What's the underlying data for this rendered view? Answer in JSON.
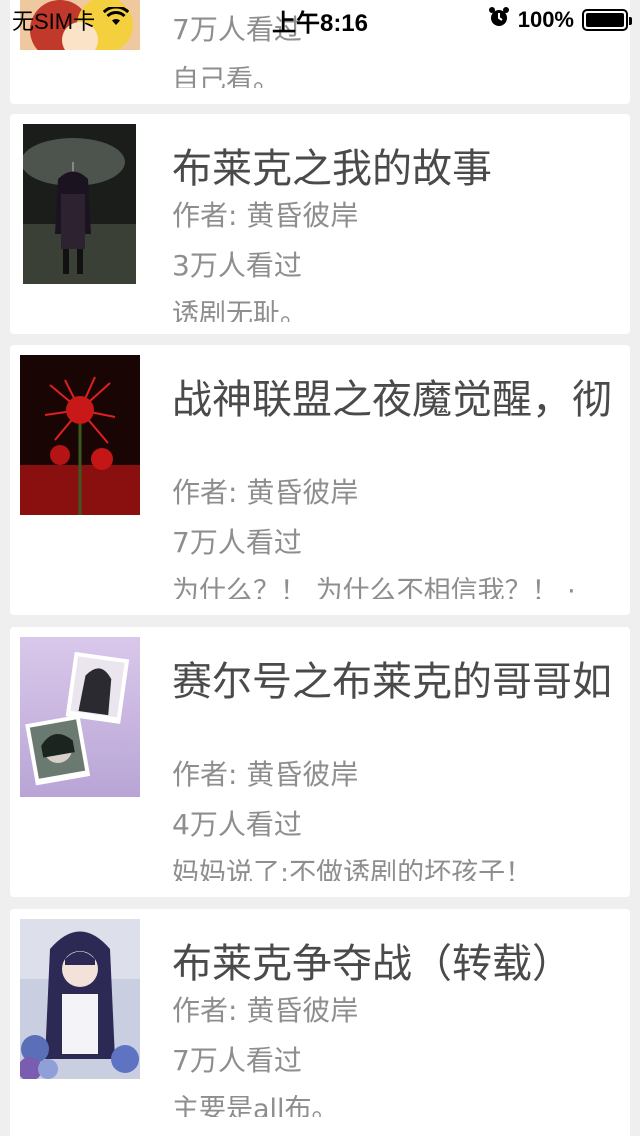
{
  "status_bar": {
    "carrier": "无SIM卡",
    "time": "上午8:16",
    "battery": "100%"
  },
  "books": [
    {
      "title": "",
      "author": "",
      "views": "7万人看过",
      "summary": "自己看。",
      "cover_icon": "anime-character-cover"
    },
    {
      "title": "布莱克之我的故事",
      "author": "作者: 黄昏彼岸",
      "views": "3万人看过",
      "summary": "诱剧无耻。",
      "cover_icon": "girl-with-umbrella-cover"
    },
    {
      "title": "战神联盟之夜魔觉醒，彻",
      "author": "作者: 黄昏彼岸",
      "views": "7万人看过",
      "summary": "为什么？！ 为什么不相信我？！ ·",
      "cover_icon": "red-spider-lily-cover"
    },
    {
      "title": "赛尔号之布莱克的哥哥如",
      "author": "作者: 黄昏彼岸",
      "views": "4万人看过",
      "summary": "妈妈说了:不做诱剧的坏孩子！",
      "cover_icon": "two-anime-portraits-cover"
    },
    {
      "title": "布莱克争夺战（转载）",
      "author": "作者: 黄昏彼岸",
      "views": "7万人看过",
      "summary": "主要是all布。",
      "cover_icon": "girl-with-hydrangea-cover"
    }
  ]
}
